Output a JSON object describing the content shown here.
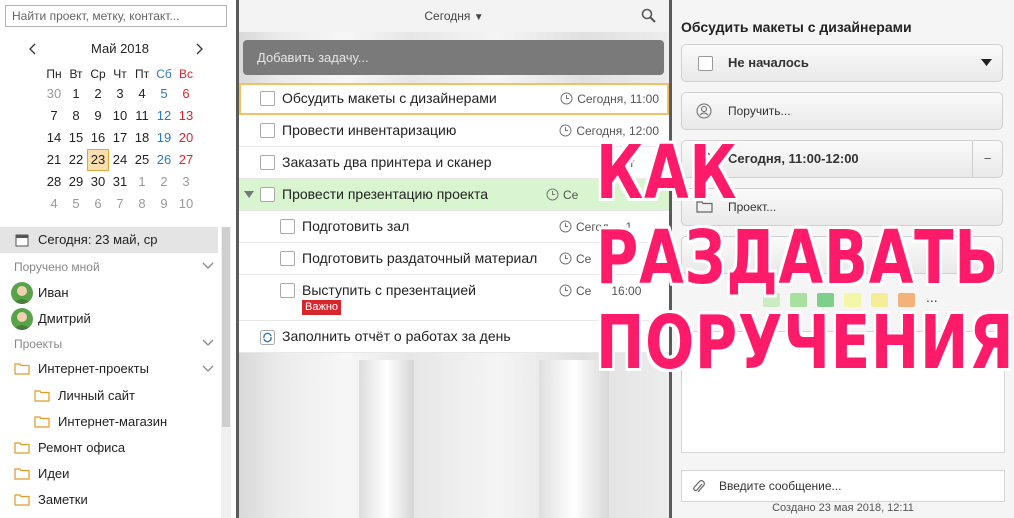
{
  "search": {
    "placeholder": "Найти проект, метку, контакт..."
  },
  "calendar": {
    "title": "Май 2018",
    "weekdays": [
      "Пн",
      "Вт",
      "Ср",
      "Чт",
      "Пт",
      "Сб",
      "Вс"
    ],
    "weeks": [
      [
        "30",
        "1",
        "2",
        "3",
        "4",
        "5",
        "6"
      ],
      [
        "7",
        "8",
        "9",
        "10",
        "11",
        "12",
        "13"
      ],
      [
        "14",
        "15",
        "16",
        "17",
        "18",
        "19",
        "20"
      ],
      [
        "21",
        "22",
        "23",
        "24",
        "25",
        "26",
        "27"
      ],
      [
        "28",
        "29",
        "30",
        "31",
        "1",
        "2",
        "3"
      ],
      [
        "4",
        "5",
        "6",
        "7",
        "8",
        "9",
        "10"
      ]
    ]
  },
  "nav": {
    "today": "Сегодня: 23 май, ср",
    "assigned_section": "Поручено мной",
    "people": [
      "Иван",
      "Дмитрий"
    ],
    "projects_section": "Проекты",
    "internet_projects": "Интернет-проекты",
    "personal_site": "Личный сайт",
    "online_store": "Интернет-магазин",
    "office_repair": "Ремонт офиса",
    "ideas": "Идеи",
    "notes": "Заметки"
  },
  "middle": {
    "view_title": "Сегодня",
    "add_task_placeholder": "Добавить задачу...",
    "tasks": [
      {
        "title": "Обсудить макеты с дизайнерами",
        "time": "Сегодня, 11:00"
      },
      {
        "title": "Провести инвентаризацию",
        "time": "Сегодня, 12:00"
      },
      {
        "title": "Заказать два принтера и сканер",
        "time": "Сег"
      },
      {
        "title": "Провести презентацию проекта",
        "time": "Се"
      },
      {
        "title": "Подготовить зал",
        "time": "Сегод     1"
      },
      {
        "title": "Подготовить раздаточный материал",
        "time": "Се"
      },
      {
        "title": "Выступить с презентацией",
        "time": "Се      16:00",
        "badge": "Важно"
      },
      {
        "title": "Заполнить отчёт о работах за день",
        "time": ""
      }
    ]
  },
  "details": {
    "title": "Обсудить макеты с дизайнерами",
    "status": "Не началось",
    "assign": "Поручить...",
    "when": "Сегодня, 11:00-12:00",
    "when_clear": "−",
    "project": "Проект...",
    "colors": [
      "#c9ecc0",
      "#a8e0a0",
      "#7ecf8a",
      "#f4f7a6",
      "#f5ee98",
      "#f4b27a"
    ],
    "more": "...",
    "message_placeholder": "Введите сообщение...",
    "created": "Создано 23 мая 2018, 12:11"
  },
  "overlay": {
    "line1": "КАК",
    "line2": "РАЗДАВАТЬ",
    "line3": "ПОРУЧЕНИЯ"
  }
}
